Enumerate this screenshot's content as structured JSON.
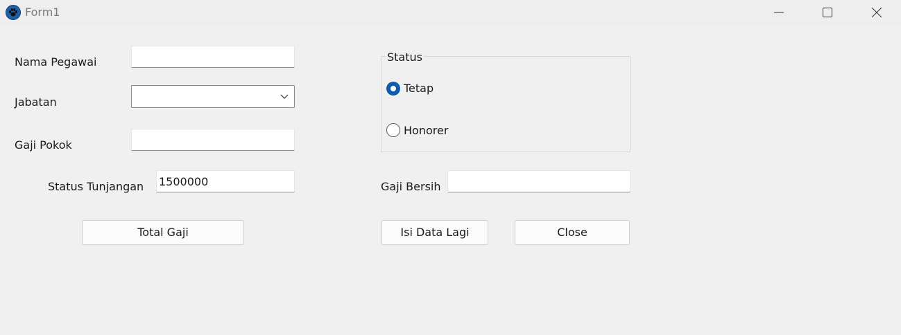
{
  "window": {
    "title": "Form1",
    "icon": "paw-icon",
    "controls": {
      "minimize": "minimize-icon",
      "maximize": "maximize-icon",
      "close": "close-icon"
    }
  },
  "form": {
    "nama_pegawai": {
      "label": "Nama Pegawai",
      "value": ""
    },
    "jabatan": {
      "label": "Jabatan",
      "selected": ""
    },
    "gaji_pokok": {
      "label": "Gaji Pokok",
      "value": ""
    },
    "status_tunjangan": {
      "label": "Status Tunjangan",
      "value": "1500000"
    },
    "gaji_bersih": {
      "label": "Gaji Bersih",
      "value": ""
    },
    "status": {
      "title": "Status",
      "options": [
        {
          "label": "Tetap",
          "checked": true
        },
        {
          "label": "Honorer",
          "checked": false
        }
      ]
    }
  },
  "buttons": {
    "total_gaji": "Total Gaji",
    "isi_data_lagi": "Isi Data Lagi",
    "close": "Close"
  },
  "colors": {
    "accent": "#0f5cad",
    "background": "#f0f0f0"
  }
}
